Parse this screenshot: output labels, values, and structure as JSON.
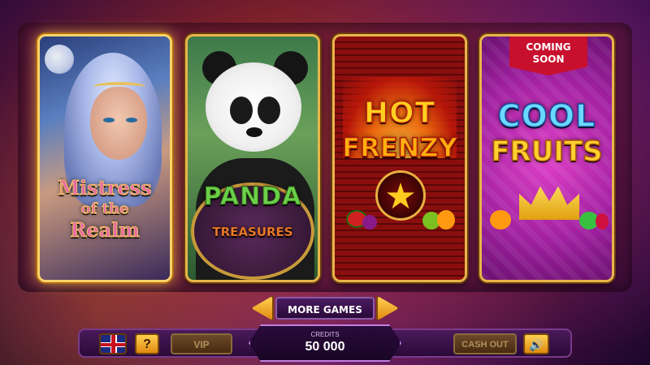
{
  "games": [
    {
      "logo_line1": "Mistress",
      "logo_line2": "of the",
      "logo_line3": "Realm",
      "selected": true
    },
    {
      "logo_line1": "PANDA",
      "logo_line2": "TREASURES",
      "selected": false
    },
    {
      "logo_line1": "HOT",
      "logo_line2": "FRENZY",
      "selected": false
    },
    {
      "logo_line1": "COOL",
      "logo_line2": "FRUITS",
      "badge_line1": "COMING",
      "badge_line2": "SOON",
      "selected": false
    }
  ],
  "navigation": {
    "more_games_label": "MORE GAMES",
    "prev_icon": "arrow-left-icon",
    "next_icon": "arrow-right-icon"
  },
  "bottom_bar": {
    "language_icon": "uk-flag-icon",
    "help_label": "?",
    "vip_label": "VIP",
    "credits_label": "CREDITS",
    "credits_value": "50 000",
    "cashout_label": "CASH OUT",
    "sound_icon": "speaker-icon"
  },
  "colors": {
    "accent_gold": "#e8b54a",
    "badge_red": "#c8102e"
  }
}
